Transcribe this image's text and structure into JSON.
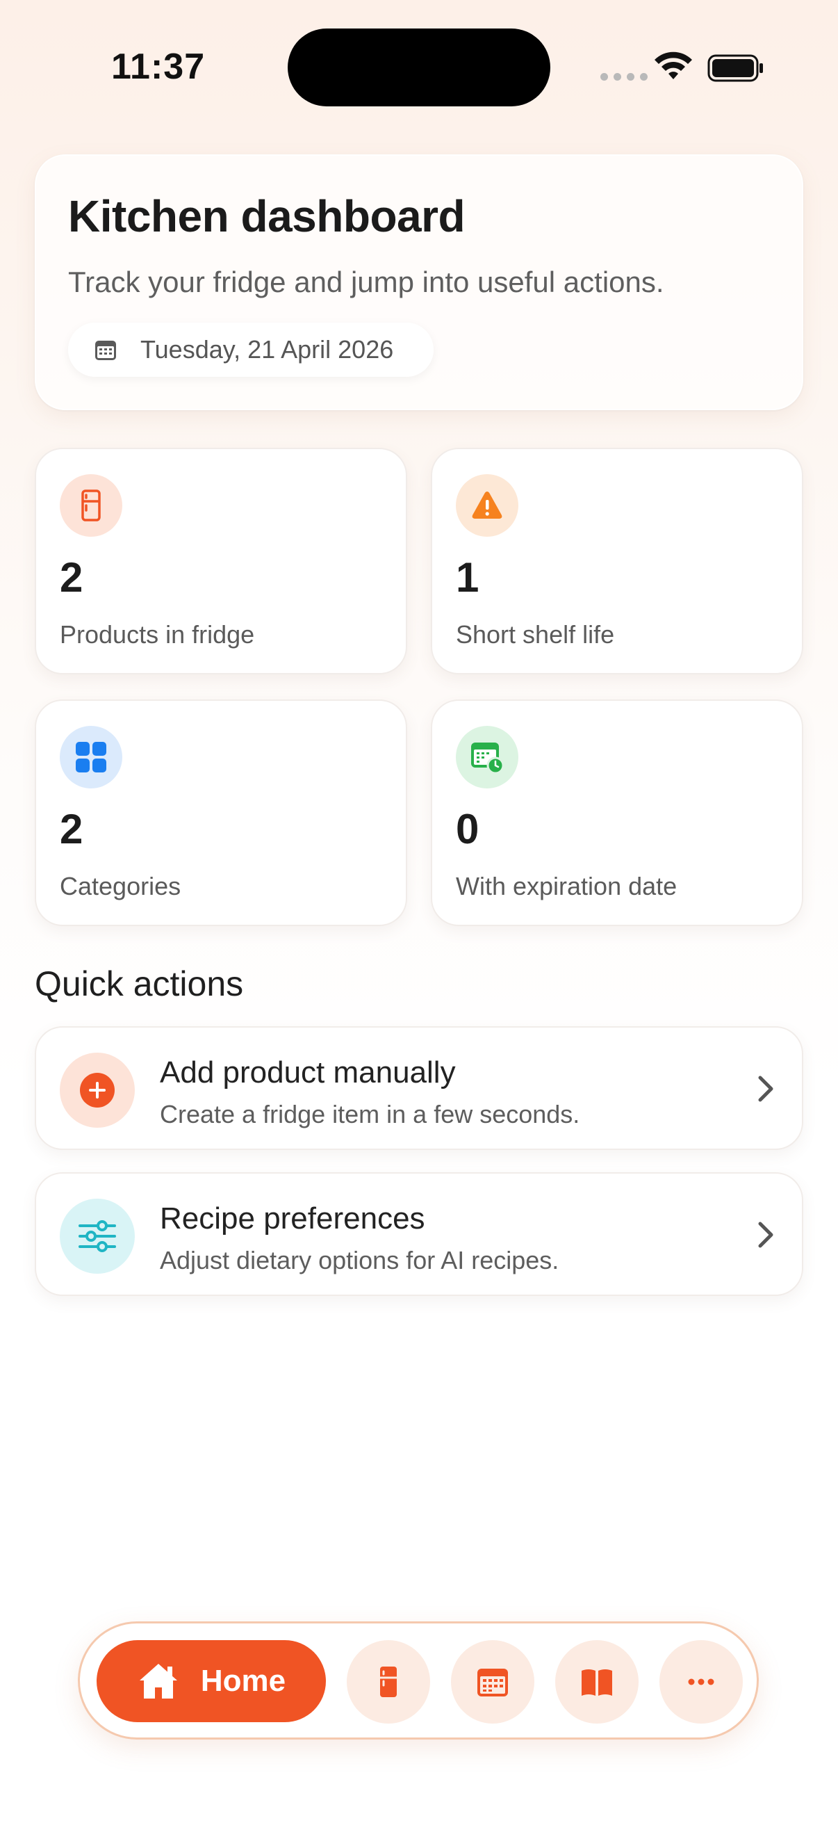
{
  "status_bar": {
    "time": "11:37"
  },
  "header": {
    "title": "Kitchen dashboard",
    "subtitle": "Track your fridge and jump into useful actions.",
    "date": "Tuesday, 21 April 2026"
  },
  "stats": [
    {
      "value": "2",
      "label": "Products in fridge",
      "icon": "fridge-icon",
      "color": "#f05424",
      "bg": "#fde3d8"
    },
    {
      "value": "1",
      "label": "Short shelf life",
      "icon": "warning-icon",
      "color": "#f6821f",
      "bg": "#fde8d6"
    },
    {
      "value": "2",
      "label": "Categories",
      "icon": "grid-icon",
      "color": "#1a7ef0",
      "bg": "#dbeafc"
    },
    {
      "value": "0",
      "label": "With expiration date",
      "icon": "calendar-clock-icon",
      "color": "#28b04a",
      "bg": "#dcf4e2"
    }
  ],
  "quick_actions": {
    "title": "Quick actions",
    "items": [
      {
        "title": "Add product manually",
        "subtitle": "Create a fridge item in a few seconds.",
        "icon": "plus-circle-icon",
        "color": "#f05424",
        "bg": "#fde3d8"
      },
      {
        "title": "Recipe preferences",
        "subtitle": "Adjust dietary options for AI recipes.",
        "icon": "sliders-icon",
        "color": "#1fb5c4",
        "bg": "#d9f4f6"
      }
    ]
  },
  "bottom_nav": {
    "home_label": "Home",
    "items": [
      "home-icon",
      "fridge-icon",
      "calendar-icon",
      "book-icon",
      "more-icon"
    ],
    "accent": "#f05424"
  }
}
